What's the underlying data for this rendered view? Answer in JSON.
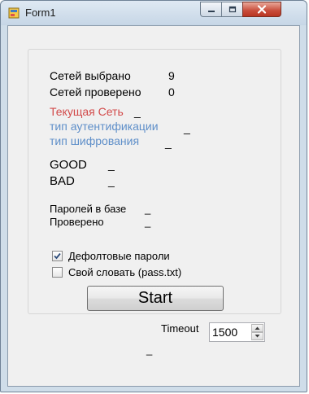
{
  "window": {
    "title": "Form1",
    "icon": "form-app-icon",
    "controls": [
      "minimize-icon",
      "maximize-icon",
      "close-icon"
    ]
  },
  "stats": {
    "networks_selected_label": "Сетей выбрано",
    "networks_selected_value": "9",
    "networks_checked_label": "Сетей проверено",
    "networks_checked_value": "0"
  },
  "current": {
    "network_label": "Текущая Сеть",
    "network_value": "_",
    "auth_label": "тип аутентификации",
    "auth_value": "_",
    "cipher_label": "тип шифрования",
    "cipher_value": "_"
  },
  "results": {
    "good_label": "GOOD",
    "good_value": "_",
    "bad_label": "BAD",
    "bad_value": "_"
  },
  "passwords": {
    "in_base_label": "Паролей в базе",
    "in_base_value": "_",
    "checked_label": "Проверено",
    "checked_value": "_"
  },
  "options": {
    "default_passwords_label": "Дефолтовые пароли",
    "default_passwords_checked": true,
    "own_dictionary_label": "Свой словать (pass.txt)",
    "own_dictionary_checked": false
  },
  "start_button": "Start",
  "timeout": {
    "label": "Timeout",
    "value": "1500"
  },
  "status_text": "_",
  "colors": {
    "current_network": "#d24a4a",
    "auth_cipher": "#5f8fc9",
    "close_button": "#c84c3a"
  }
}
